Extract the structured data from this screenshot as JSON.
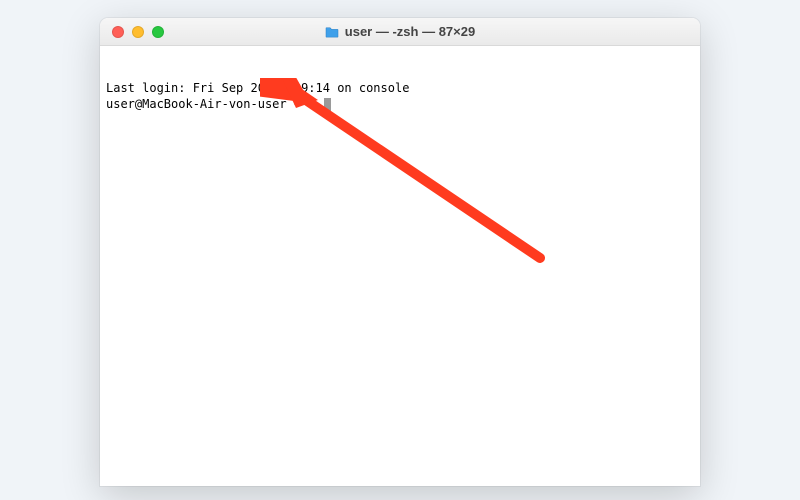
{
  "window": {
    "title": "user — -zsh — 87×29"
  },
  "terminal": {
    "last_login_line": "Last login: Fri Sep 20 16:09:14 on console",
    "prompt": "user@MacBook-Air-von-user ~ % "
  },
  "annotation": {
    "color": "#ff3b1f"
  }
}
